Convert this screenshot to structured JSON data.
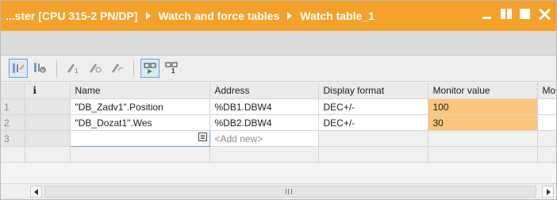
{
  "title": {
    "crumbs": [
      "...ster [CPU 315-2 PN/DP]",
      "Watch and force tables",
      "Watch table_1"
    ],
    "controls": [
      "minimize-icon",
      "tile-icon",
      "maximize-icon",
      "close-icon"
    ]
  },
  "toolbar": {
    "buttons": [
      "insert-row-icon",
      "add-row-icon",
      "modify-now-icon",
      "modify-with-trigger-icon",
      "enable-peripheral-outputs-icon",
      "monitor-all-icon",
      "monitor-now-icon"
    ]
  },
  "table": {
    "columns": [
      "",
      "",
      "Name",
      "Address",
      "Display format",
      "Monitor value",
      "Mo"
    ],
    "rows": [
      {
        "num": "1",
        "name": "\"DB_Zadv1\".Position",
        "address": "%DB1.DBW4",
        "format": "DEC+/-",
        "monitor": "100"
      },
      {
        "num": "2",
        "name": "\"DB_Dozat1\".Wes",
        "address": "%DB2.DBW4",
        "format": "DEC+/-",
        "monitor": "30"
      }
    ],
    "new_row": {
      "num": "3",
      "placeholder": "<Add new>"
    }
  },
  "colors": {
    "title_bar": "#f3a12a",
    "monitor_highlight": "#fbc67c"
  }
}
